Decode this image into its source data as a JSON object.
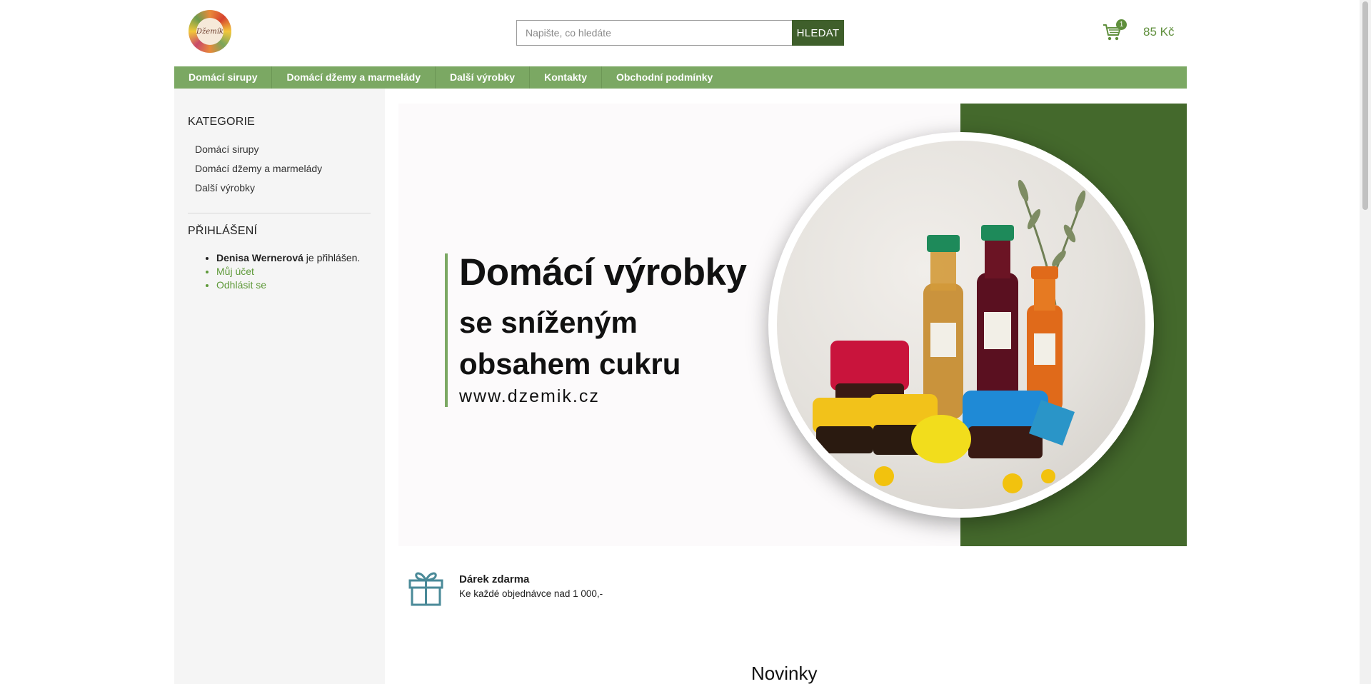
{
  "header": {
    "logo_text": "Džemík",
    "search_placeholder": "Napište, co hledáte",
    "search_button": "HLEDAT",
    "cart_count": "1",
    "cart_price": "85 Kč"
  },
  "nav": {
    "items": [
      {
        "label": "Domácí sirupy"
      },
      {
        "label": "Domácí džemy a marmelády"
      },
      {
        "label": "Další výrobky"
      },
      {
        "label": "Kontakty"
      },
      {
        "label": "Obchodní podmínky"
      }
    ]
  },
  "sidebar": {
    "categories_heading": "KATEGORIE",
    "categories": [
      {
        "label": "Domácí sirupy"
      },
      {
        "label": "Domácí džemy a marmelády"
      },
      {
        "label": "Další výrobky"
      }
    ],
    "login_heading": "PŘIHLÁŠENÍ",
    "user_name": "Denisa Wernerová",
    "logged_in_text": " je přihlášen.",
    "my_account": "Můj účet",
    "logout": "Odhlásit se"
  },
  "banner": {
    "line1": "Domácí výrobky",
    "line2": "se sníženým",
    "line3": "obsahem cukru",
    "url": "www.dzemik.cz"
  },
  "promo": {
    "title": "Dárek zdarma",
    "subtitle": "Ke každé objednávce nad 1 000,-"
  },
  "section": {
    "news_heading": "Novinky"
  },
  "colors": {
    "nav_green": "#7ba863",
    "dark_green": "#44692c",
    "link_green": "#5f9a3a",
    "button_green": "#3f5f2b",
    "icon_teal": "#4a8a98"
  }
}
